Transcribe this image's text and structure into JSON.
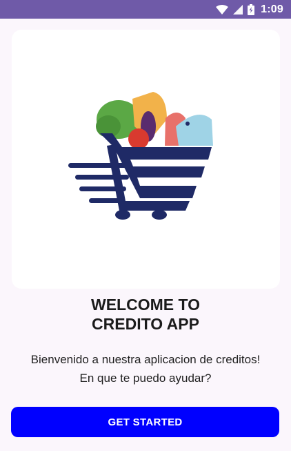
{
  "status_bar": {
    "time": "1:09",
    "icons": [
      "wifi-icon",
      "signal-icon",
      "battery-icon"
    ],
    "color": "#6F5AA8"
  },
  "hero": {
    "image_name": "grocery-cart-logo",
    "colors": {
      "cart": "#1F2A66",
      "lettuce": "#5BA845",
      "tomato": "#D93A2F",
      "eggplant": "#5A2C6E",
      "fish": "#9FD3E6",
      "bread": "#F2B24A",
      "meat": "#E8716A"
    }
  },
  "welcome": {
    "line1": "WELCOME TO",
    "line2": "CREDITO APP"
  },
  "message": {
    "line1": "Bienvenido a nuestra aplicacion de creditos!",
    "line2": "En que te puedo ayudar?"
  },
  "cta": {
    "label": "GET STARTED",
    "color": "#0000FF"
  }
}
